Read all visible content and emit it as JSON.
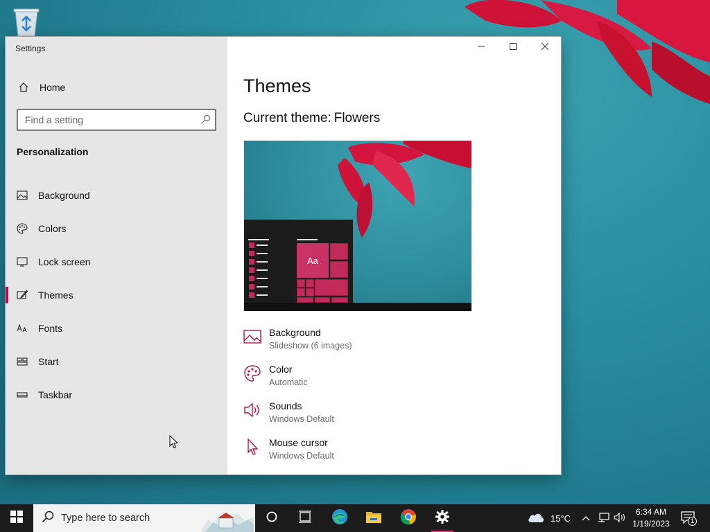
{
  "desktop": {
    "recycle_bin_icon": "recycle-bin-icon"
  },
  "window": {
    "title": "Settings",
    "caption": {
      "minimize_icon": "minimize-icon",
      "maximize_icon": "maximize-icon",
      "close_icon": "close-icon"
    }
  },
  "sidebar": {
    "home_label": "Home",
    "search_placeholder": "Find a setting",
    "section_title": "Personalization",
    "items": [
      {
        "label": "Background",
        "icon": "picture-icon"
      },
      {
        "label": "Colors",
        "icon": "palette-icon"
      },
      {
        "label": "Lock screen",
        "icon": "monitor-icon"
      },
      {
        "label": "Themes",
        "icon": "brush-icon",
        "active": true
      },
      {
        "label": "Fonts",
        "icon": "fonts-icon"
      },
      {
        "label": "Start",
        "icon": "start-layout-icon"
      },
      {
        "label": "Taskbar",
        "icon": "taskbar-icon"
      }
    ]
  },
  "main": {
    "page_title": "Themes",
    "current_theme_label": "Current theme:",
    "current_theme_name": "Flowers",
    "preview_tile_text": "Aa",
    "properties": [
      {
        "name": "Background",
        "value": "Slideshow (6 images)",
        "icon": "picture-icon"
      },
      {
        "name": "Color",
        "value": "Automatic",
        "icon": "palette-icon"
      },
      {
        "name": "Sounds",
        "value": "Windows Default",
        "icon": "speaker-icon"
      },
      {
        "name": "Mouse cursor",
        "value": "Windows Default",
        "icon": "cursor-icon"
      }
    ]
  },
  "taskbar": {
    "search_placeholder": "Type here to search",
    "apps": [
      "cortana-icon",
      "task-view-icon",
      "edge-icon",
      "file-explorer-icon",
      "chrome-icon",
      "settings-icon"
    ],
    "weather": "15°C",
    "time": "6:34 AM",
    "date": "1/19/2023",
    "notification_count": "1"
  },
  "colors": {
    "accent": "#c30052",
    "sidebar_bg": "#e6e6e6",
    "taskbar_bg": "#1c1c1c"
  }
}
